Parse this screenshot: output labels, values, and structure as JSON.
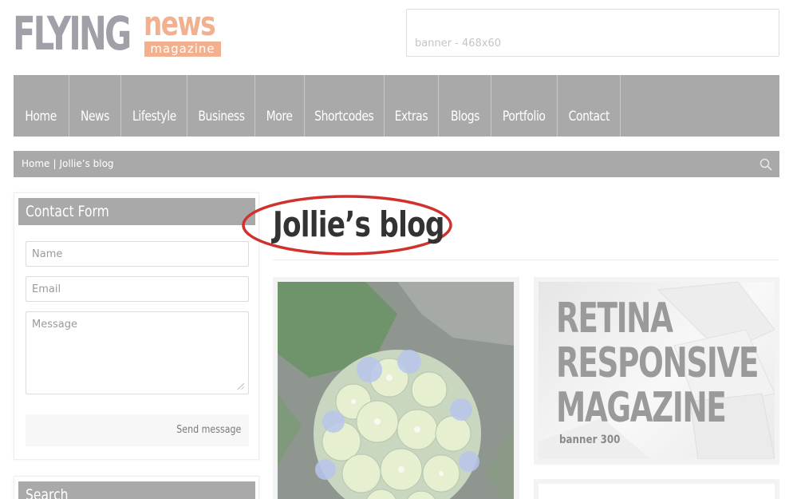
{
  "header": {
    "logo": {
      "word1": "FLYING",
      "word2": "news",
      "word3": "magazine"
    },
    "banner_top": "banner - 468x60"
  },
  "nav": {
    "items": [
      {
        "label": "Home"
      },
      {
        "label": "News"
      },
      {
        "label": "Lifestyle"
      },
      {
        "label": "Business"
      },
      {
        "label": "More"
      },
      {
        "label": "Shortcodes"
      },
      {
        "label": "Extras"
      },
      {
        "label": "Blogs"
      },
      {
        "label": "Portfolio"
      },
      {
        "label": "Contact"
      }
    ]
  },
  "breadcrumb": {
    "home": "Home",
    "separator": "|",
    "current": "Jollie’s blog",
    "search_icon": "search-icon"
  },
  "sidebar": {
    "contact": {
      "title": "Contact Form",
      "name_placeholder": "Name",
      "email_placeholder": "Email",
      "message_placeholder": "Message",
      "send_label": "Send message"
    },
    "search": {
      "title": "Search"
    }
  },
  "main": {
    "title": "Jollie’s blog",
    "highlight_color": "#d0312d",
    "banner": {
      "line1": "RETINA",
      "line2": "RESPONSIVE",
      "line3": "MAGAZINE",
      "caption": "banner 300"
    }
  },
  "colors": {
    "nav_bg": "#a9a9a9",
    "accent": "#f3b08f"
  }
}
